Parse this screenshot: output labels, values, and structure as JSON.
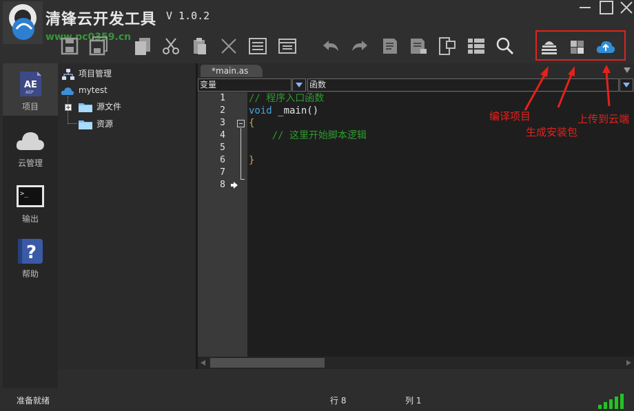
{
  "app": {
    "title": "清锋云开发工具",
    "version": "V 1.0.2",
    "watermark_url": "www.pc0359.cn"
  },
  "toolbar": {
    "icons": [
      "save-icon",
      "save-all-icon",
      "copy-icon",
      "cut-icon",
      "paste-icon",
      "delete-icon",
      "list-icon",
      "panel-icon",
      "undo-icon",
      "redo-icon",
      "document-icon",
      "document-edit-icon",
      "layout-icon",
      "grid-list-icon",
      "search-icon"
    ],
    "cloud_icons": [
      "compile-icon",
      "package-icon",
      "cloud-upload-icon"
    ]
  },
  "sidenav": {
    "items": [
      {
        "label": "项目",
        "icon": "ae-project-icon",
        "active": true
      },
      {
        "label": "云管理",
        "icon": "cloud-icon",
        "active": false
      },
      {
        "label": "输出",
        "icon": "terminal-icon",
        "active": false
      },
      {
        "label": "帮助",
        "icon": "help-book-icon",
        "active": false
      }
    ]
  },
  "tree": {
    "root_label": "项目管理",
    "project": "mytest",
    "children": [
      "源文件",
      "资源"
    ]
  },
  "editor": {
    "tab_label": "*main.as",
    "var_combo": "变量",
    "func_combo": "函数",
    "line_numbers": [
      "1",
      "2",
      "3",
      "4",
      "5",
      "6",
      "7",
      "8"
    ],
    "lines": [
      {
        "text": "// 程序入口函数",
        "type": "comment"
      },
      {
        "text": "void _main()",
        "type": "code"
      },
      {
        "text": "{",
        "type": "brace"
      },
      {
        "text": "    // 这里开始脚本逻辑",
        "type": "comment"
      },
      {
        "text": "",
        "type": "code"
      },
      {
        "text": "}",
        "type": "brace"
      },
      {
        "text": "",
        "type": "code"
      },
      {
        "text": "",
        "type": "code"
      }
    ]
  },
  "annotations": {
    "compile": "编译项目",
    "package": "生成安装包",
    "upload": "上传到云端",
    "color": "#e3221c"
  },
  "status": {
    "ready": "准备就绪",
    "line": "行 8",
    "column": "列 1"
  }
}
